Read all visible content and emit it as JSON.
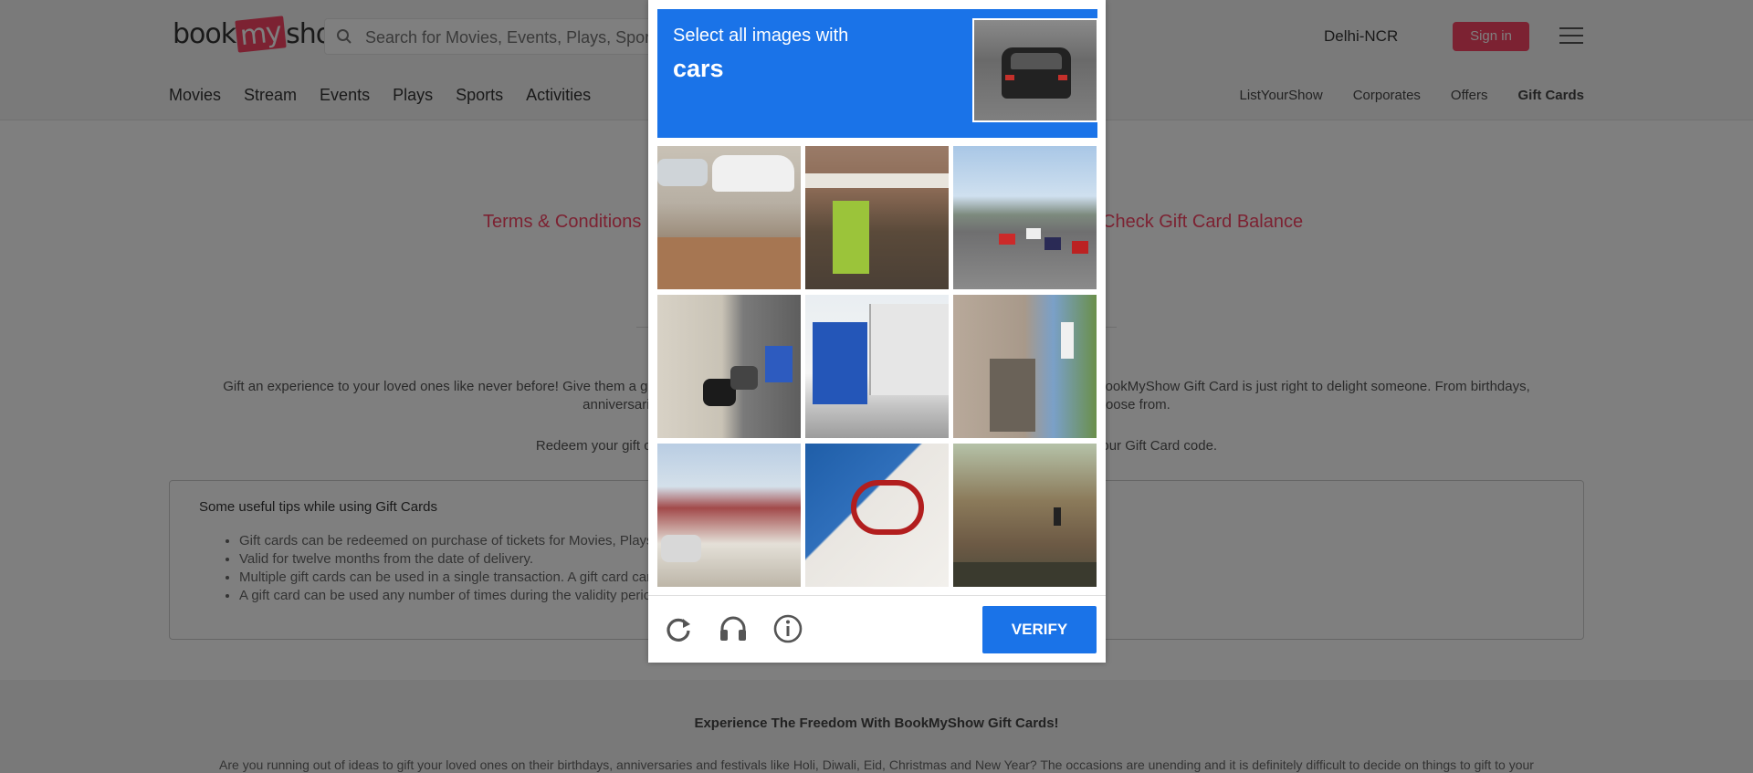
{
  "header": {
    "logo_left": "book",
    "logo_mid": "my",
    "logo_right": "show",
    "search_placeholder": "Search for Movies, Events, Plays, Sports and Activities",
    "city": "Delhi-NCR",
    "signin": "Sign in"
  },
  "subnav": {
    "left": [
      "Movies",
      "Stream",
      "Events",
      "Plays",
      "Sports",
      "Activities"
    ],
    "right": [
      "ListYourShow",
      "Corporates",
      "Offers",
      "Gift Cards"
    ]
  },
  "links": {
    "terms": "Terms & Conditions",
    "balance": "Check Gift Card Balance"
  },
  "content": {
    "description": "Gift an experience to your loved ones like never before! Give them a gift card and let them choose what they want. Whatever be the occasion, a BookMyShow Gift Card is just right to delight someone. From birthdays, anniversaries, festivals to thank you notes, there are a number of gift cards you can choose from.",
    "redeem": "Redeem your gift card at the select cinemas. Login to your BookMyShow account and enter your Gift Card code.",
    "tips_title": "Some useful tips while using Gift Cards",
    "tips": [
      "Gift cards can be redeemed on purchase of tickets for Movies, Plays, Events and Sports.",
      "Valid for twelve months from the date of delivery.",
      "Multiple gift cards can be used in a single transaction. A gift card can be used any number of times till the balance is exhausted.",
      "A gift card can be used any number of times during the validity period."
    ]
  },
  "footer": {
    "title": "Experience The Freedom With BookMyShow Gift Cards!",
    "text": "Are you running out of ideas to gift your loved ones on their birthdays, anniversaries and festivals like Holi, Diwali, Eid, Christmas and New Year? The occasions are unending and it is definitely difficult to decide on things to gift to your"
  },
  "captcha": {
    "instruction": "Select all images with",
    "target": "cars",
    "verify_label": "VERIFY",
    "tiles": [
      "parking-lot-cars",
      "market-stall",
      "highway-traffic",
      "street-parked-cars",
      "shop-building",
      "sidewalk-wall",
      "house-with-car",
      "motorcycle-billboard",
      "apartment-traffic-light"
    ],
    "icons": [
      "reload-icon",
      "audio-challenge-icon",
      "info-icon"
    ],
    "colors": {
      "accent": "#1a73e8"
    }
  }
}
